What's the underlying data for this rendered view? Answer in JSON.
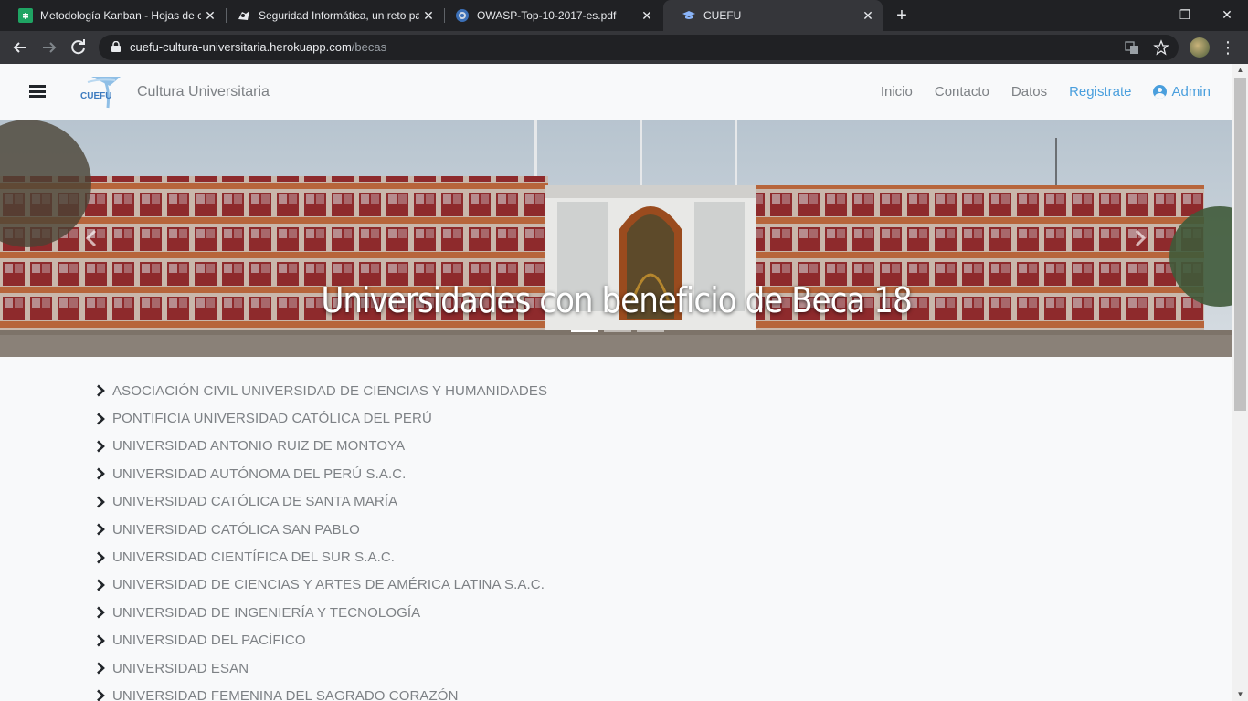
{
  "browser": {
    "tabs": [
      {
        "title": "Metodología Kanban - Hojas de c",
        "icon": "sheets-icon"
      },
      {
        "title": "Seguridad Informática, un reto pa",
        "icon": "site-icon"
      },
      {
        "title": "OWASP-Top-10-2017-es.pdf",
        "icon": "globe-icon"
      },
      {
        "title": "CUEFU",
        "icon": "graduation-cap-icon"
      }
    ],
    "new_tab": "+",
    "url_host": "cuefu-cultura-universitaria.herokuapp.com",
    "url_path": "/becas",
    "window": {
      "minimize": "—",
      "restore": "❐",
      "close": "✕"
    }
  },
  "navbar": {
    "logo_text": "CUEFU",
    "brand": "Cultura Universitaria",
    "links": {
      "inicio": "Inicio",
      "contacto": "Contacto",
      "datos": "Datos",
      "registrate": "Registrate",
      "admin": "Admin"
    }
  },
  "carousel": {
    "caption": "Universidades con beneficio de Beca 18",
    "slide_count": 3,
    "active_slide": 1
  },
  "universities": [
    "ASOCIACIÓN CIVIL UNIVERSIDAD DE CIENCIAS Y HUMANIDADES",
    "PONTIFICIA UNIVERSIDAD CATÓLICA DEL PERÚ",
    "UNIVERSIDAD ANTONIO RUIZ DE MONTOYA",
    "UNIVERSIDAD AUTÓNOMA DEL PERÚ S.A.C.",
    "UNIVERSIDAD CATÓLICA DE SANTA MARÍA",
    "UNIVERSIDAD CATÓLICA SAN PABLO",
    "UNIVERSIDAD CIENTÍFICA DEL SUR S.A.C.",
    "UNIVERSIDAD DE CIENCIAS Y ARTES DE AMÉRICA LATINA S.A.C.",
    "UNIVERSIDAD DE INGENIERÍA Y TECNOLOGÍA",
    "UNIVERSIDAD DEL PACÍFICO",
    "UNIVERSIDAD ESAN",
    "UNIVERSIDAD FEMENINA DEL SAGRADO CORAZÓN"
  ],
  "colors": {
    "link_blue": "#4a9fdd",
    "muted_text": "#7d8185",
    "chrome_dark": "#202124",
    "chrome_toolbar": "#35363a"
  }
}
